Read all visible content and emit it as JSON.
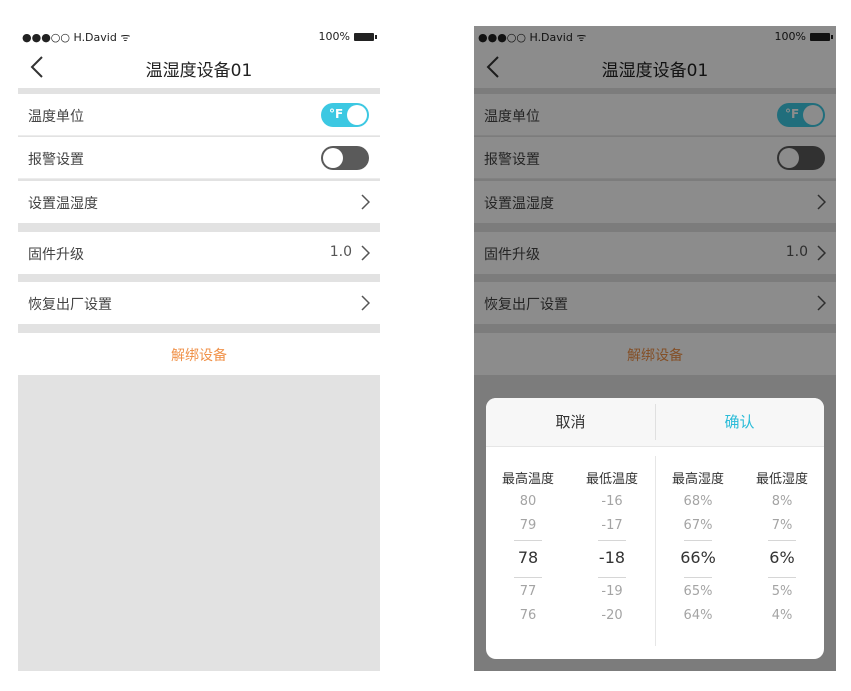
{
  "status": {
    "carrier": "●●●○○ H.David ᯤ",
    "battery": "100%"
  },
  "nav": {
    "title": "温湿度设备01"
  },
  "settings": {
    "temp_unit_label": "温度单位",
    "temp_unit_value": "°F",
    "alarm_label": "报警设置",
    "set_temp_hum_label": "设置温湿度",
    "firmware_label": "固件升级",
    "firmware_version": "1.0",
    "factory_reset_label": "恢复出厂设置",
    "unbind_label": "解绑设备"
  },
  "picker": {
    "cancel_label": "取消",
    "confirm_label": "确认",
    "columns": [
      {
        "header": "最高温度",
        "options": [
          "80",
          "79",
          "78",
          "77",
          "76"
        ],
        "selected": "78"
      },
      {
        "header": "最低温度",
        "options": [
          "-16",
          "-17",
          "-18",
          "-19",
          "-20"
        ],
        "selected": "-18"
      },
      {
        "header": "最高湿度",
        "options": [
          "68%",
          "67%",
          "66%",
          "65%",
          "64%"
        ],
        "selected": "66%"
      },
      {
        "header": "最低湿度",
        "options": [
          "8%",
          "7%",
          "6%",
          "5%",
          "4%"
        ],
        "selected": "6%"
      }
    ]
  },
  "colors": {
    "accent": "#3cc8e2",
    "unbind": "#f0924a",
    "confirm": "#2bbcd8"
  }
}
